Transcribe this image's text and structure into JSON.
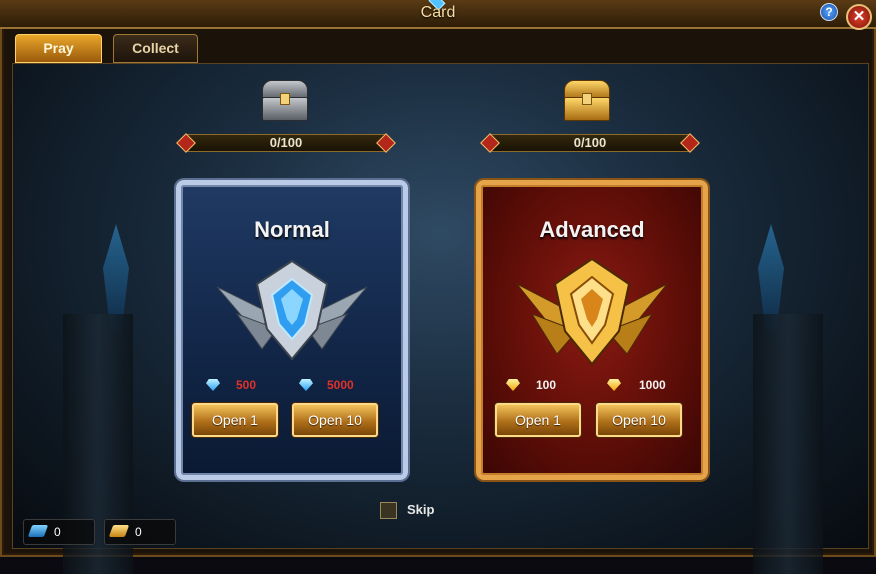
{
  "window": {
    "title": "Card",
    "help_label": "?",
    "close_label": "✕"
  },
  "tabs": [
    {
      "label": "Pray",
      "active": true
    },
    {
      "label": "Collect",
      "active": false
    }
  ],
  "normal": {
    "progress": "0/100",
    "progress_fraction": 0.0,
    "title": "Normal",
    "price_single": "500",
    "price_ten": "5000",
    "currency_icon": "blue-diamond-icon",
    "open1_label": "Open 1",
    "open10_label": "Open 10"
  },
  "advanced": {
    "progress": "0/100",
    "progress_fraction": 0.0,
    "title": "Advanced",
    "price_single": "100",
    "price_ten": "1000",
    "currency_icon": "gold-diamond-icon",
    "open1_label": "Open 1",
    "open10_label": "Open 10"
  },
  "skip": {
    "label": "Skip",
    "checked": false
  },
  "resources": [
    {
      "icon": "blue-scroll-icon",
      "value": "0"
    },
    {
      "icon": "gold-scroll-icon",
      "value": "0"
    }
  ],
  "colors": {
    "normal_price": "#e0312a",
    "advanced_price": "#f4f4f4",
    "accent_gold": "#e6a44a"
  }
}
